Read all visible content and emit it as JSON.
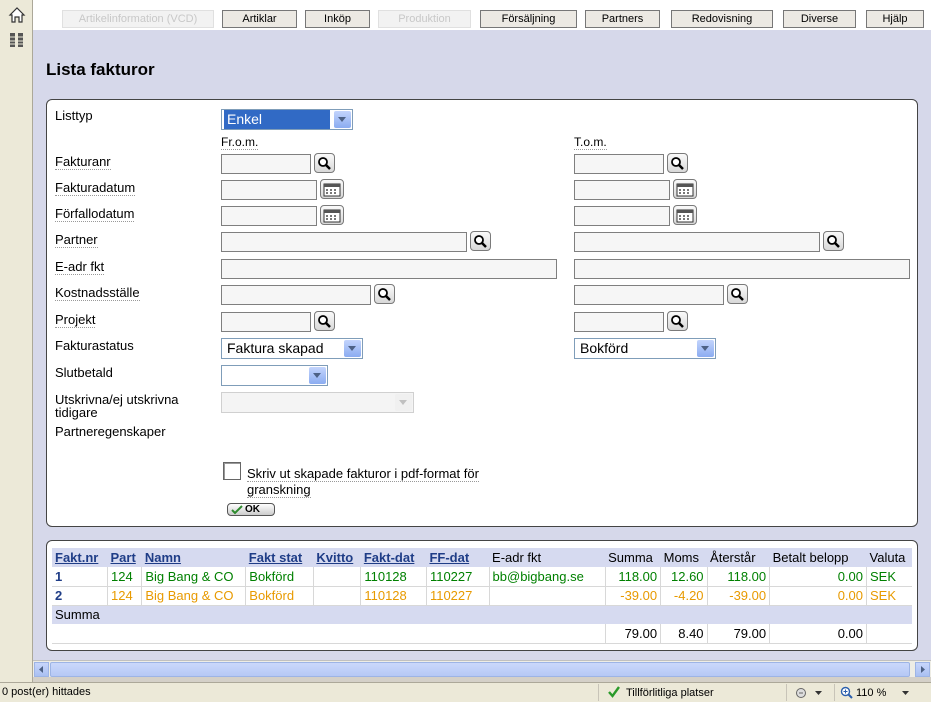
{
  "tabs": [
    {
      "label": "Artikelinformation (VCD)",
      "disabled": true
    },
    {
      "label": "Artiklar",
      "disabled": false
    },
    {
      "label": "Inköp",
      "disabled": false
    },
    {
      "label": "Produktion",
      "disabled": true
    },
    {
      "label": "Försäljning",
      "disabled": false
    },
    {
      "label": "Partners",
      "disabled": false
    },
    {
      "label": "Redovisning",
      "disabled": false
    },
    {
      "label": "Diverse",
      "disabled": false
    },
    {
      "label": "Hjälp",
      "disabled": false
    }
  ],
  "page_title": "Lista fakturor",
  "filters": {
    "listtyp_label": "Listtyp",
    "listtyp_value": "Enkel",
    "from_label": "Fr.o.m.",
    "tom_label": "T.o.m.",
    "fakturanr_label": "Fakturanr",
    "fakturadatum_label": "Fakturadatum",
    "forfallodatum_label": "Förfallodatum",
    "partner_label": "Partner",
    "eadr_label": "E-adr fkt",
    "kostnadsstalle_label": "Kostnadsställe",
    "projekt_label": "Projekt",
    "fakturastatus_label": "Fakturastatus",
    "fakturastatus_from": "Faktura skapad",
    "fakturastatus_tom": "Bokförd",
    "slutbetald_label": "Slutbetald",
    "utskrivna_label": "Utskrivna/ej utskrivna tidigare",
    "partneregenskaper_label": "Partneregenskaper",
    "pdf_checkbox_label": "Skriv ut skapade fakturor i pdf-format för granskning",
    "ok_label": "OK"
  },
  "table": {
    "headers": [
      "Fakt.nr",
      "Part",
      "Namn",
      "Fakt stat",
      "Kvitto",
      "Fakt-dat",
      "FF-dat",
      "E-adr fkt",
      "Summa",
      "Moms",
      "Återstår",
      "Betalt belopp",
      "Valuta"
    ],
    "rows": [
      {
        "faktnr": "1",
        "part": "124",
        "namn": "Big Bang & CO",
        "status": "Bokförd",
        "kvitto": "",
        "faktdat": "110128",
        "ffdat": "110227",
        "eadr": "bb@bigbang.se",
        "summa": "118.00",
        "moms": "12.60",
        "aterstar": "118.00",
        "betalt": "0.00",
        "valuta": "SEK"
      },
      {
        "faktnr": "2",
        "part": "124",
        "namn": "Big Bang & CO",
        "status": "Bokförd",
        "kvitto": "",
        "faktdat": "110128",
        "ffdat": "110227",
        "eadr": "",
        "summa": "-39.00",
        "moms": "-4.20",
        "aterstar": "-39.00",
        "betalt": "0.00",
        "valuta": "SEK"
      }
    ],
    "sum_label": "Summa",
    "totals": {
      "summa": "79.00",
      "moms": "8.40",
      "aterstar": "79.00",
      "betalt": "0.00"
    }
  },
  "statusbar": {
    "found_text": "0 post(er) hittades",
    "zone_text": "Tillförlitliga platser",
    "zoom_text": "110 %"
  },
  "colors": {
    "header_blue": "#1f3d87",
    "row_green": "#008000",
    "row_orange": "#e89a00",
    "bg_lavender": "#d6d8ea"
  },
  "icons": [
    "home-icon",
    "list-icon",
    "search-icon",
    "calendar-icon",
    "checkmark-icon"
  ]
}
